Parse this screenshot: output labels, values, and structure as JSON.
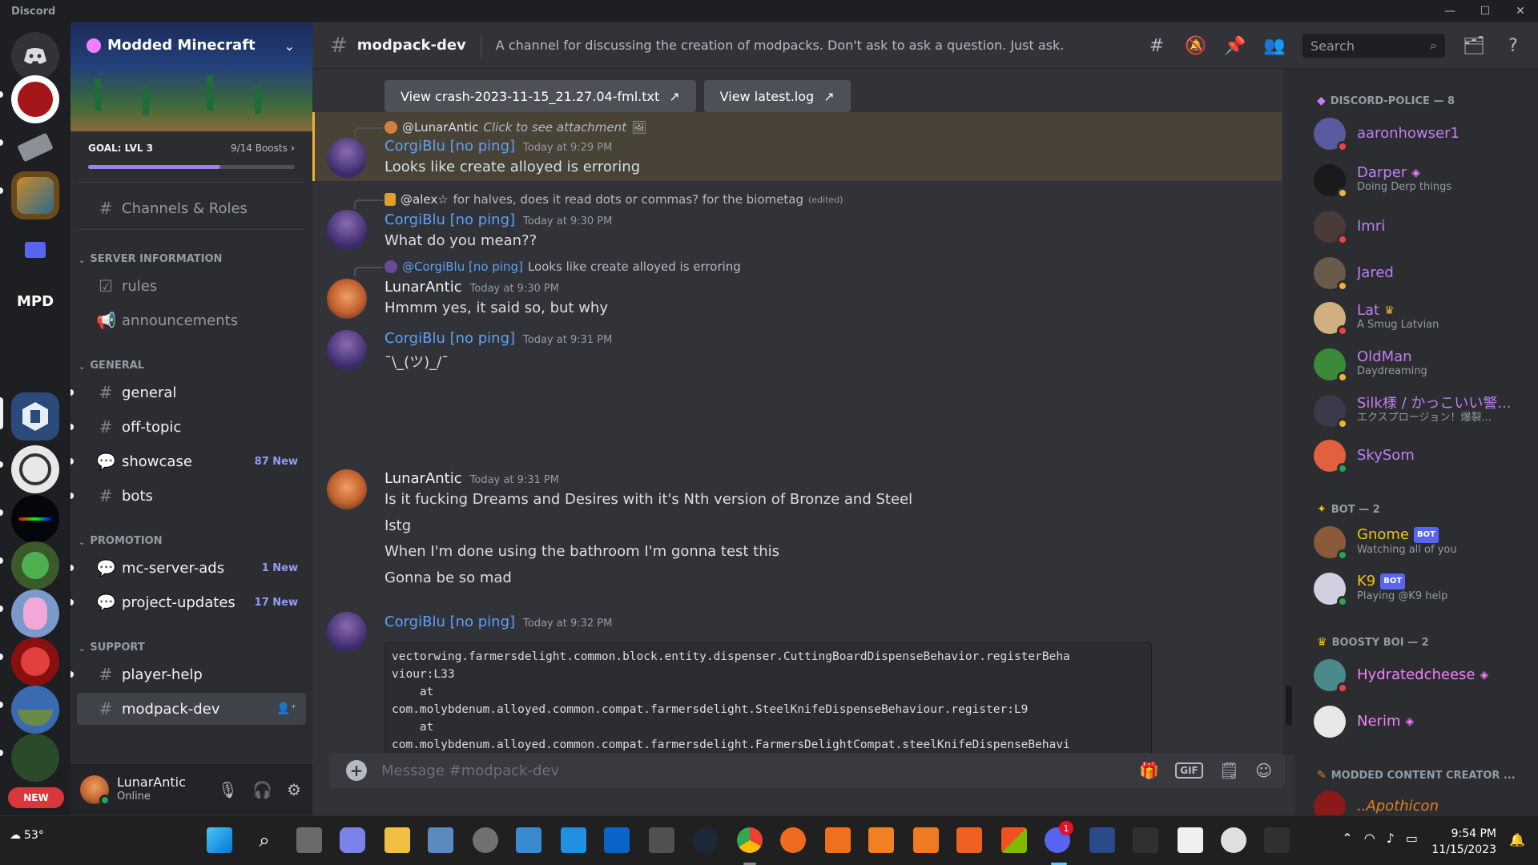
{
  "app": {
    "title": "Discord",
    "window_controls": [
      "—",
      "☐",
      "✕"
    ]
  },
  "server": {
    "name": "Modded Minecraft",
    "goal_label": "GOAL: LVL 3",
    "boosts": "9/14 Boosts",
    "boost_progress": 0.64
  },
  "server_rail": {
    "new_badge": "NEW",
    "mpd_label": "MPD"
  },
  "sidebar": {
    "channels_roles": "Channels & Roles",
    "categories": [
      {
        "name": "SERVER INFORMATION"
      },
      {
        "name": "GENERAL"
      },
      {
        "name": "PROMOTION"
      },
      {
        "name": "SUPPORT"
      }
    ],
    "channels": {
      "rules": "rules",
      "announcements": "announcements",
      "general": "general",
      "off_topic": "off-topic",
      "showcase": "showcase",
      "showcase_new": "87 New",
      "bots": "bots",
      "mc_server_ads": "mc-server-ads",
      "mc_server_ads_new": "1 New",
      "project_updates": "project-updates",
      "project_updates_new": "17 New",
      "player_help": "player-help",
      "modpack_dev": "modpack-dev"
    }
  },
  "user": {
    "name": "LunarAntic",
    "status": "Online"
  },
  "header": {
    "channel": "modpack-dev",
    "topic": "A channel for discussing the creation of modpacks. Don't ask to ask a question. Just ask.",
    "search_placeholder": "Search"
  },
  "messages": {
    "btn_crash": "View crash-2023-11-15_21.27.04-fml.txt",
    "btn_log": "View latest.log",
    "m1": {
      "reply_name": "@LunarAntic",
      "reply_text": "Click to see attachment",
      "author": "CorgiBlu [no ping]",
      "time": "Today at 9:29 PM",
      "text": "Looks like create alloyed is erroring"
    },
    "m2": {
      "reply_name": "@alex☆",
      "reply_text": "for halves, does it read dots or commas? for the biometag",
      "reply_edited": "(edited)",
      "author": "CorgiBlu [no ping]",
      "time": "Today at 9:30 PM",
      "text": "What do you mean??"
    },
    "m3": {
      "reply_name": "@CorgiBlu [no ping]",
      "reply_text": "Looks like create alloyed is erroring",
      "author": "LunarAntic",
      "time": "Today at 9:30 PM",
      "text": "Hmmm yes, it said so, but why"
    },
    "m4": {
      "author": "CorgiBlu [no ping]",
      "time": "Today at 9:31 PM",
      "text": "¯\\_(ツ)_/¯"
    },
    "m5": {
      "author": "LunarAntic",
      "time": "Today at 9:31 PM",
      "lines": [
        "Is it fucking Dreams and Desires with it's Nth version of Bronze and Steel",
        "Istg",
        "When I'm done using the bathroom I'm gonna test this",
        "Gonna be so mad"
      ]
    },
    "m6": {
      "author": "CorgiBlu [no ping]",
      "time": "Today at 9:32 PM",
      "code": "vectorwing.farmersdelight.common.block.entity.dispenser.CuttingBoardDispenseBehavior.registerBeha\nviour:L33\n    at\ncom.molybdenum.alloyed.common.compat.farmersdelight.SteelKnifeDispenseBehaviour.register:L9\n    at\ncom.molybdenum.alloyed.common.compat.farmersdelight.FarmersDelightCompat.steelKnifeDispenseBehavi"
    }
  },
  "composer": {
    "placeholder": "Message #modpack-dev",
    "gif": "GIF"
  },
  "members": {
    "groups": {
      "police": "DISCORD-POLICE — 8",
      "bot": "BOT — 2",
      "boosty": "BOOSTY BOI — 2",
      "creator": "MODDED CONTENT CREATOR ..."
    },
    "list": {
      "aaronhowser1": {
        "name": "aaronhowser1"
      },
      "darper": {
        "name": "Darper",
        "sub": "Doing Derp things"
      },
      "imri": {
        "name": "Imri"
      },
      "jared": {
        "name": "Jared"
      },
      "lat": {
        "name": "Lat",
        "sub": "A Smug Latvian"
      },
      "oldman": {
        "name": "OldMan",
        "sub": "Daydreaming"
      },
      "silk": {
        "name": "Silk様 / かっこいい警...",
        "sub": "エクスプロージョン！爆裂..."
      },
      "skysom": {
        "name": "SkySom"
      },
      "gnome": {
        "name": "Gnome",
        "badge": "BOT",
        "sub": "Watching all of you"
      },
      "k9": {
        "name": "K9",
        "badge": "BOT",
        "sub": "Playing @K9 help"
      },
      "hydrated": {
        "name": "Hydratedcheese"
      },
      "nerim": {
        "name": "Nerim"
      },
      "apothicon": {
        "name": "..Apothicon"
      }
    }
  },
  "taskbar": {
    "weather": "53°",
    "time": "9:54 PM",
    "date": "11/15/2023",
    "discord_badge": "1"
  },
  "colors": {
    "accent": "#5865f2",
    "link_blue": "#5ea0f5",
    "police_purple": "#c27ef5",
    "bot_gold": "#f1c40f",
    "booster_pink": "#f47fff",
    "creator_orange": "#e67e22",
    "mention_gold": "#f0b132",
    "online": "#23a55a",
    "dnd": "#f23f43",
    "idle": "#f0b232"
  }
}
